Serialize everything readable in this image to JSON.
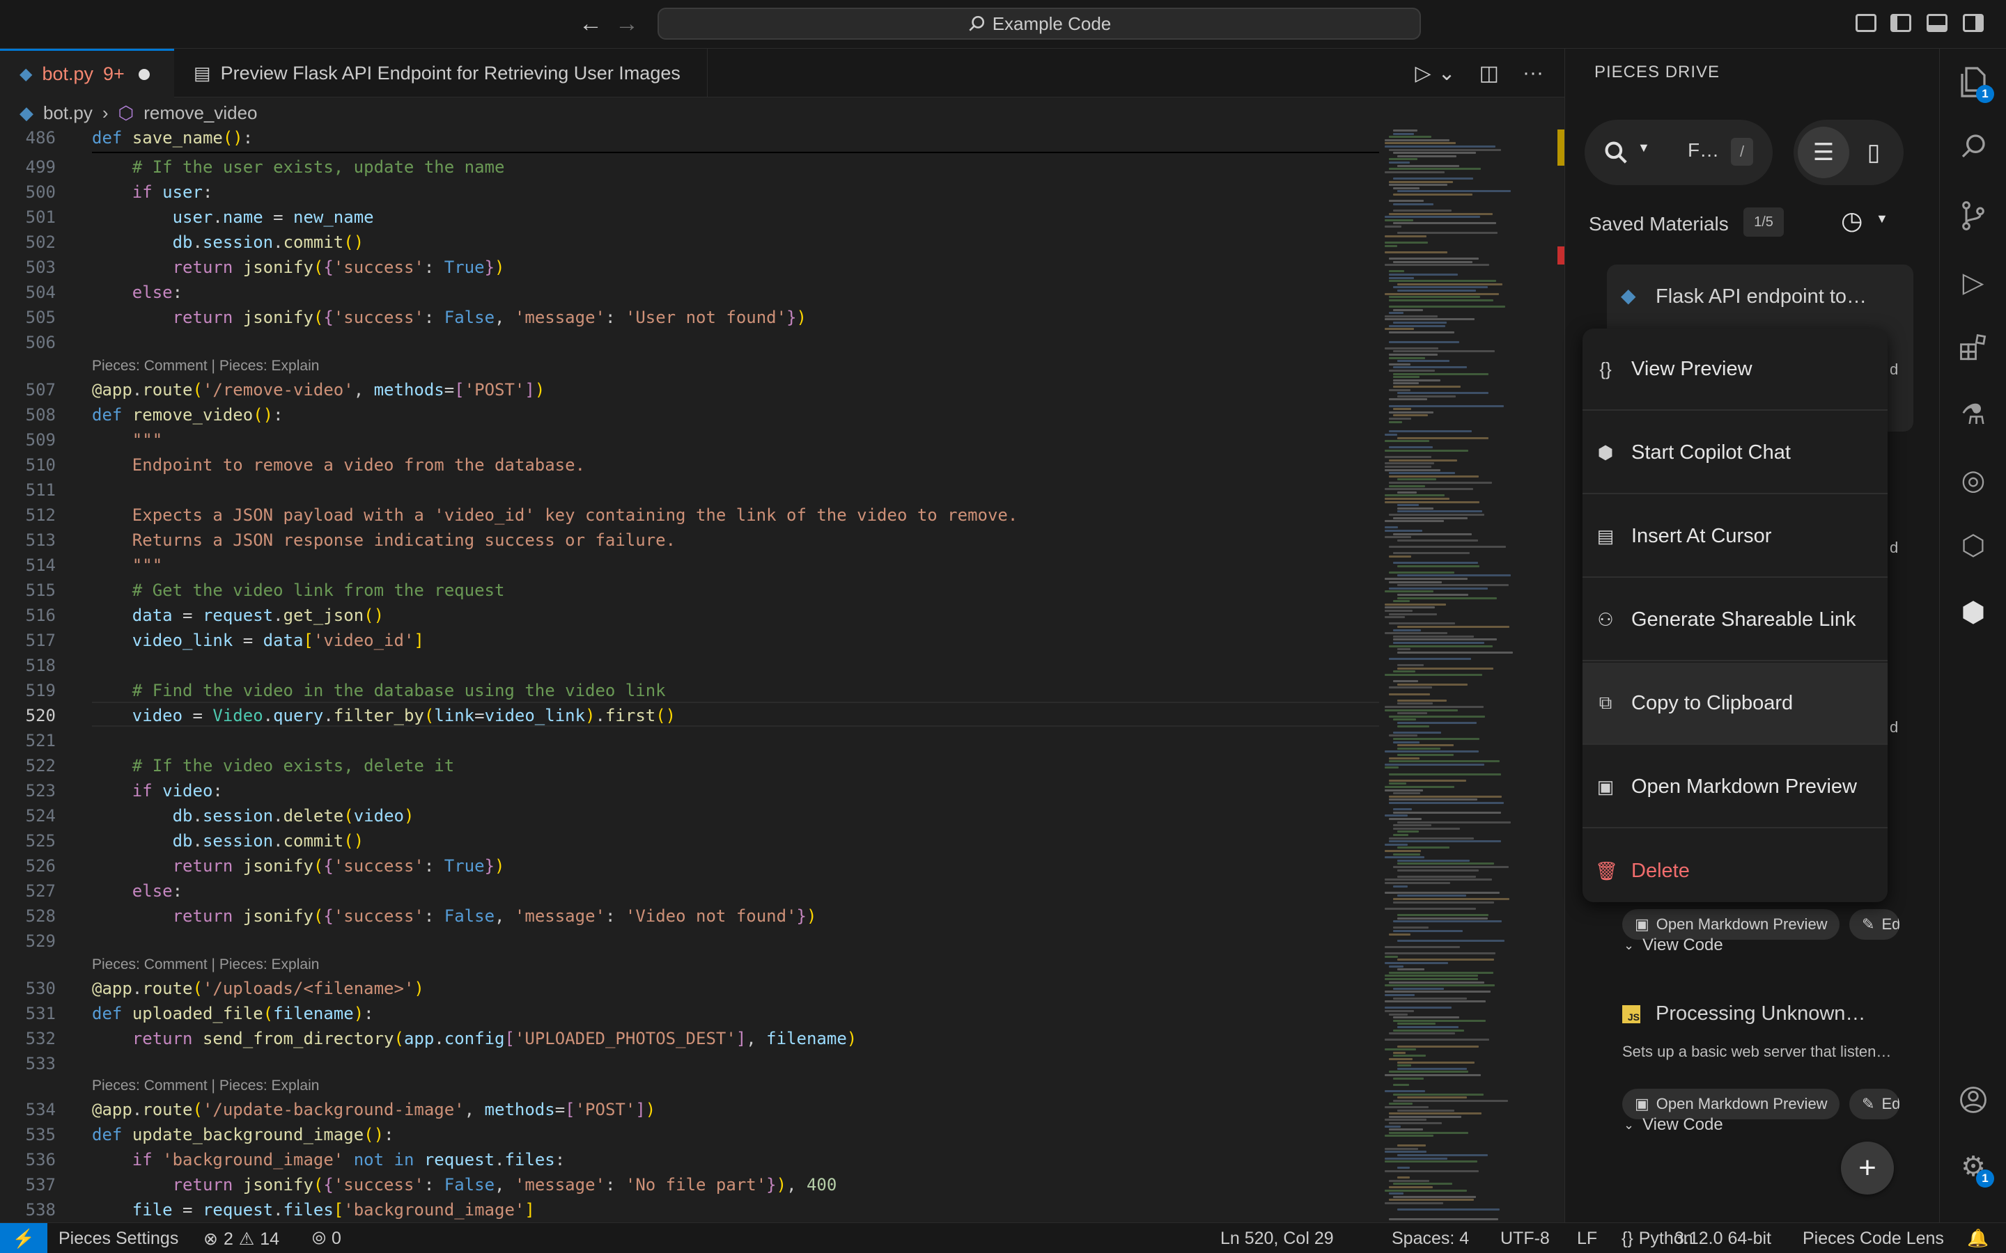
{
  "titlebar": {
    "back_icon": "arrow-left-icon",
    "forward_icon": "arrow-right-icon",
    "command_center": "Example Code",
    "search_icon": "search-icon"
  },
  "tabs": [
    {
      "label": "bot.py",
      "badge": "9+",
      "dirty": true
    },
    {
      "label": "Preview Flask API Endpoint for Retrieving User Images"
    }
  ],
  "tab_actions": {
    "run": "▷",
    "run_menu": "⌄",
    "split": "◫",
    "more": "···"
  },
  "breadcrumb": {
    "file": "bot.py",
    "separator": "›",
    "symbol": "remove_video"
  },
  "codelens_text": "Pieces: Comment | Pieces: Explain",
  "editor": {
    "current_line": 520
  },
  "pieces": {
    "title": "PIECES DRIVE",
    "search_truncated": "F…",
    "search_shortcut": "/",
    "saved_label": "Saved Materials",
    "saved_count": "1/5",
    "cards": [
      {
        "title": "Flask API endpoint to…",
        "icon": "python-icon"
      },
      {
        "title": "Processing Unknown…",
        "icon": "javascript-icon",
        "description": "Sets up a basic web server that listen…"
      }
    ],
    "open_md_label": "Open Markdown Preview",
    "edit_label": "Ed",
    "view_code_label": "View Code",
    "partial_letters": [
      "d",
      "d",
      "d"
    ],
    "add_label": "+"
  },
  "context_menu": [
    {
      "label": "View Preview",
      "icon": "braces-icon"
    },
    {
      "label": "Start Copilot Chat",
      "icon": "copilot-icon"
    },
    {
      "label": "Insert At Cursor",
      "icon": "comment-icon"
    },
    {
      "label": "Generate Shareable Link",
      "icon": "share-person-icon"
    },
    {
      "label": "Copy to Clipboard",
      "icon": "copy-icon"
    },
    {
      "label": "Open Markdown Preview",
      "icon": "markdown-preview-icon"
    },
    {
      "label": "Delete",
      "icon": "trash-icon"
    }
  ],
  "activity_badges": {
    "explorer": "1",
    "settings": "1"
  },
  "statusbar": {
    "pieces_settings": "Pieces Settings",
    "errors": "2",
    "warnings": "14",
    "ports": "0",
    "position": "Ln 520, Col 29",
    "spaces": "Spaces: 4",
    "encoding": "UTF-8",
    "eol": "LF",
    "language": "Python",
    "interpreter": "3.12.0 64-bit",
    "code_lens": "Pieces Code Lens"
  }
}
